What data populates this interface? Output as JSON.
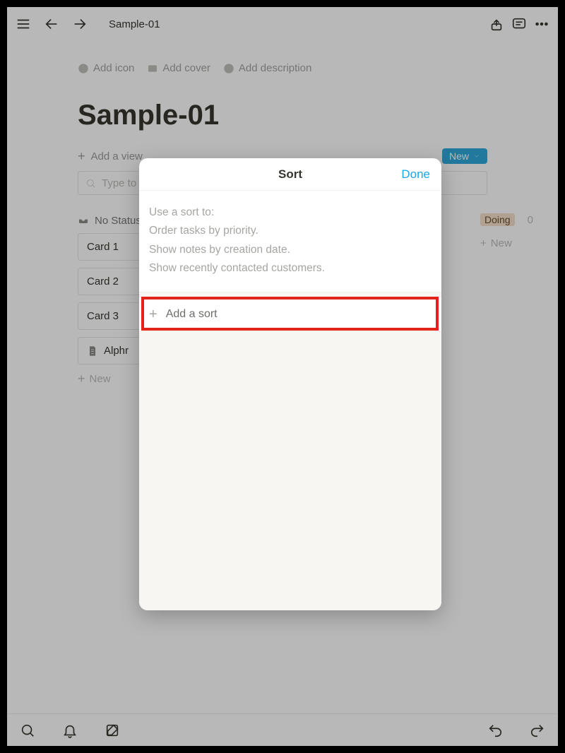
{
  "topbar": {
    "breadcrumb": "Sample-01"
  },
  "page": {
    "meta": {
      "add_icon": "Add icon",
      "add_cover": "Add cover",
      "add_description": "Add description"
    },
    "title": "Sample-01",
    "add_view": "Add a view",
    "new_button": "New",
    "search_placeholder": "Type to"
  },
  "board": {
    "col1": {
      "header": "No Status",
      "cards": [
        "Card 1",
        "Card 2",
        "Card 3"
      ],
      "alphr": "Alphr",
      "add_new": "New"
    },
    "col2": {
      "header": "Doing",
      "count": "0",
      "add_new": "New"
    }
  },
  "modal": {
    "title": "Sort",
    "done": "Done",
    "help_lines": [
      "Use a sort to:",
      "Order tasks by priority.",
      "Show notes by creation date.",
      "Show recently contacted customers."
    ],
    "add_sort": "Add a sort"
  }
}
